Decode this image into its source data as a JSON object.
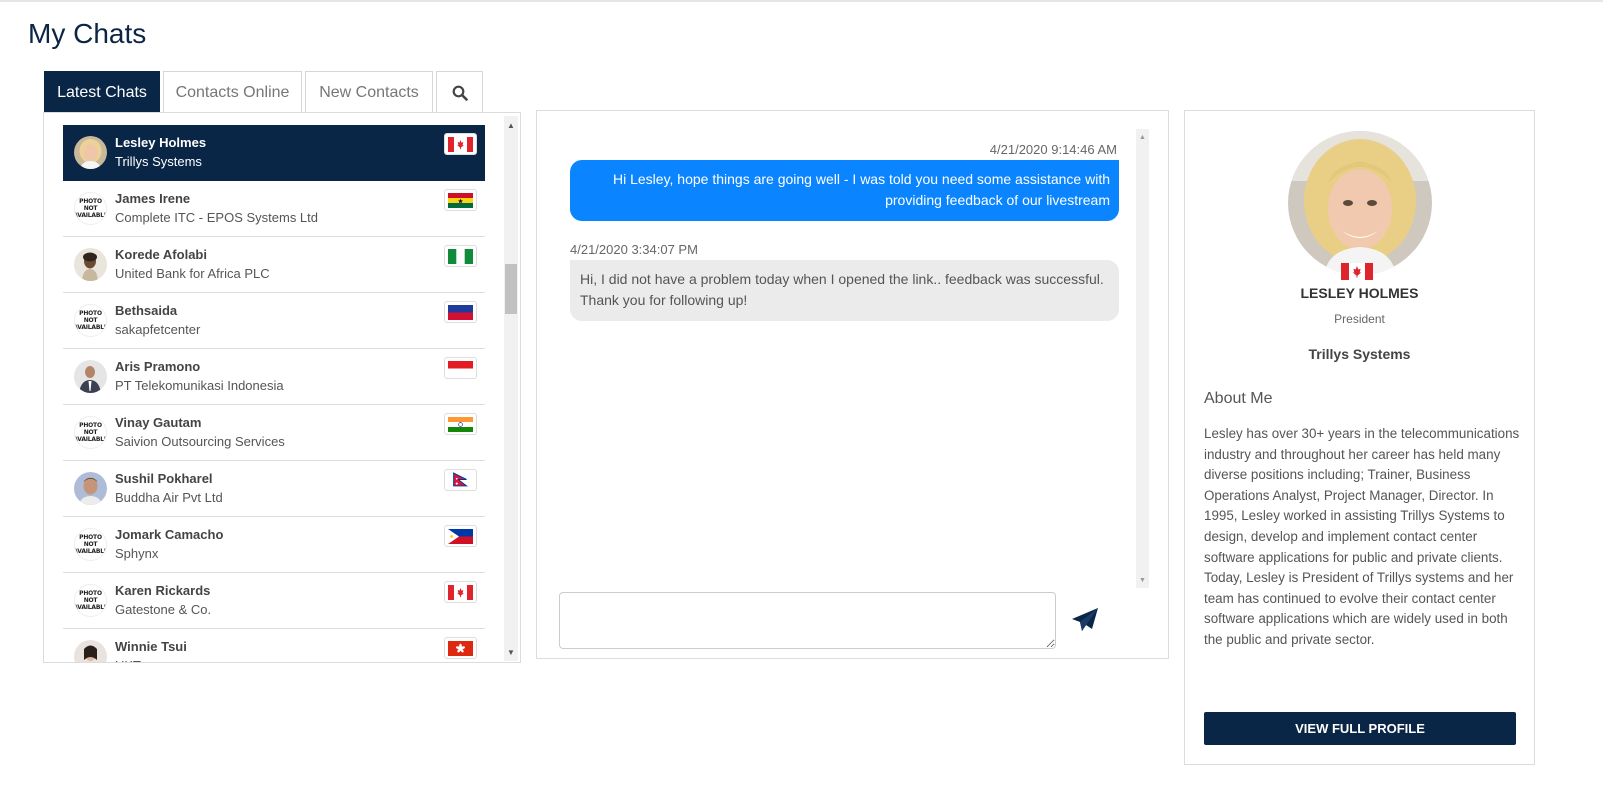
{
  "page": {
    "title": "My Chats"
  },
  "tabs": [
    {
      "label": "Latest Chats",
      "active": true
    },
    {
      "label": "Contacts Online",
      "active": false
    },
    {
      "label": "New Contacts",
      "active": false
    }
  ],
  "search_tab_icon": "search-icon",
  "contacts": [
    {
      "name": "Lesley Holmes",
      "company": "Trillys Systems",
      "flag": "canada",
      "photo": "photo",
      "active": true
    },
    {
      "name": "James Irene",
      "company": "Complete ITC - EPOS Systems Ltd",
      "flag": "ghana",
      "photo": "not-available"
    },
    {
      "name": "Korede Afolabi",
      "company": "United Bank for Africa PLC",
      "flag": "nigeria",
      "photo": "photo"
    },
    {
      "name": "Bethsaida",
      "company": "sakapfetcenter",
      "flag": "haiti",
      "photo": "not-available"
    },
    {
      "name": "Aris Pramono",
      "company": "PT Telekomunikasi Indonesia",
      "flag": "indonesia",
      "photo": "photo"
    },
    {
      "name": "Vinay Gautam",
      "company": "Saivion Outsourcing Services",
      "flag": "india",
      "photo": "not-available"
    },
    {
      "name": "Sushil Pokharel",
      "company": "Buddha Air Pvt Ltd",
      "flag": "nepal",
      "photo": "photo"
    },
    {
      "name": "Jomark Camacho",
      "company": "Sphynx",
      "flag": "philippines",
      "photo": "not-available"
    },
    {
      "name": "Karen Rickards",
      "company": "Gatestone & Co.",
      "flag": "canada",
      "photo": "not-available"
    },
    {
      "name": "Winnie Tsui",
      "company": "HKT",
      "flag": "hong-kong",
      "photo": "photo"
    }
  ],
  "photo_not_available": [
    "PHOTO",
    "NOT",
    "AVAILABLE"
  ],
  "chat": {
    "messages": [
      {
        "direction": "out",
        "time": "4/21/2020 9:14:46 AM",
        "text": "Hi Lesley, hope things are going well - I was told you need some assistance with providing feedback of our livestream"
      },
      {
        "direction": "in",
        "time": "4/21/2020 3:34:07 PM",
        "text": "Hi, I did not have a problem today when I opened the link.. feedback was successful. Thank you for following up!"
      }
    ],
    "input_value": "",
    "send_icon": "send-icon"
  },
  "profile": {
    "name": "LESLEY HOLMES",
    "role": "President",
    "company": "Trillys Systems",
    "flag": "canada",
    "about_heading": "About Me",
    "about_text": "Lesley has over 30+ years in the telecommunications industry and throughout her career has held many diverse positions including; Trainer, Business Operations Analyst, Project Manager, Director. In 1995, Lesley worked in assisting Trillys Systems to design, develop and implement contact center software applications for public and private clients. Today, Lesley is President of Trillys systems and her team has continued to evolve their contact center software applications which are widely used in both the public and private sector.",
    "button_label": "VIEW FULL PROFILE"
  },
  "colors": {
    "navy": "#0a2647",
    "outgoing_bubble": "#0a84ff",
    "incoming_bubble": "#ebebeb"
  }
}
